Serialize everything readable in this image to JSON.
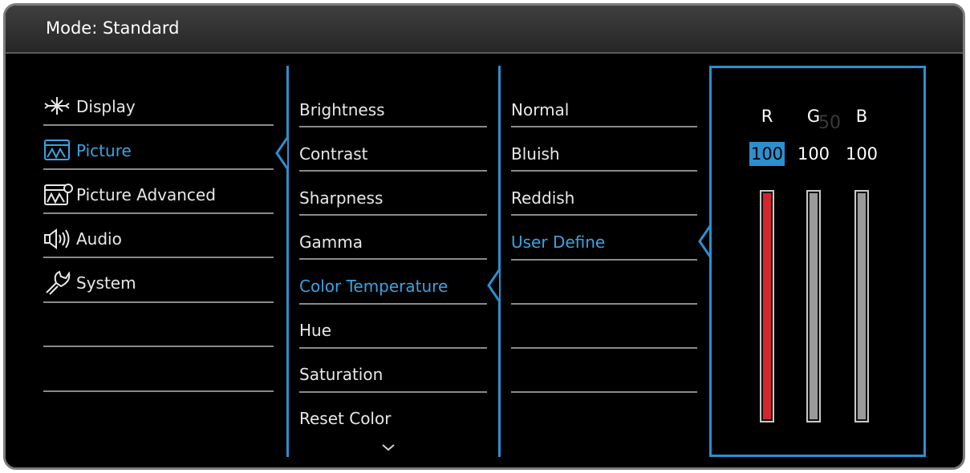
{
  "header": {
    "title": "Mode: Standard"
  },
  "main_menu": {
    "items": [
      {
        "label": "Display",
        "icon": "display-icon",
        "selected": false
      },
      {
        "label": "Picture",
        "icon": "picture-icon",
        "selected": true
      },
      {
        "label": "Picture Advanced",
        "icon": "picture-advanced-icon",
        "selected": false
      },
      {
        "label": "Audio",
        "icon": "audio-icon",
        "selected": false
      },
      {
        "label": "System",
        "icon": "system-icon",
        "selected": false
      }
    ]
  },
  "picture_menu": {
    "items": [
      {
        "label": "Brightness",
        "selected": false
      },
      {
        "label": "Contrast",
        "selected": false
      },
      {
        "label": "Sharpness",
        "selected": false
      },
      {
        "label": "Gamma",
        "selected": false
      },
      {
        "label": "Color Temperature",
        "selected": true
      },
      {
        "label": "Hue",
        "selected": false
      },
      {
        "label": "Saturation",
        "selected": false
      },
      {
        "label": "Reset Color",
        "selected": false
      }
    ],
    "more_icon": "chevron-down-icon"
  },
  "color_temp_menu": {
    "items": [
      {
        "label": "Normal",
        "selected": false
      },
      {
        "label": "Bluish",
        "selected": false
      },
      {
        "label": "Reddish",
        "selected": false
      },
      {
        "label": "User Define",
        "selected": true
      }
    ]
  },
  "user_define": {
    "ghost_value": "50",
    "channels": [
      {
        "label": "R",
        "value": "100",
        "level": 1.0,
        "color": "#d6252c",
        "selected": true
      },
      {
        "label": "G",
        "value": "100",
        "level": 1.0,
        "color": "#9a9a9a",
        "selected": false
      },
      {
        "label": "B",
        "value": "100",
        "level": 1.0,
        "color": "#9a9a9a",
        "selected": false
      }
    ]
  },
  "colors": {
    "accent": "#2d8fd0",
    "selected_text": "#3aa3e3",
    "background": "#000000"
  }
}
